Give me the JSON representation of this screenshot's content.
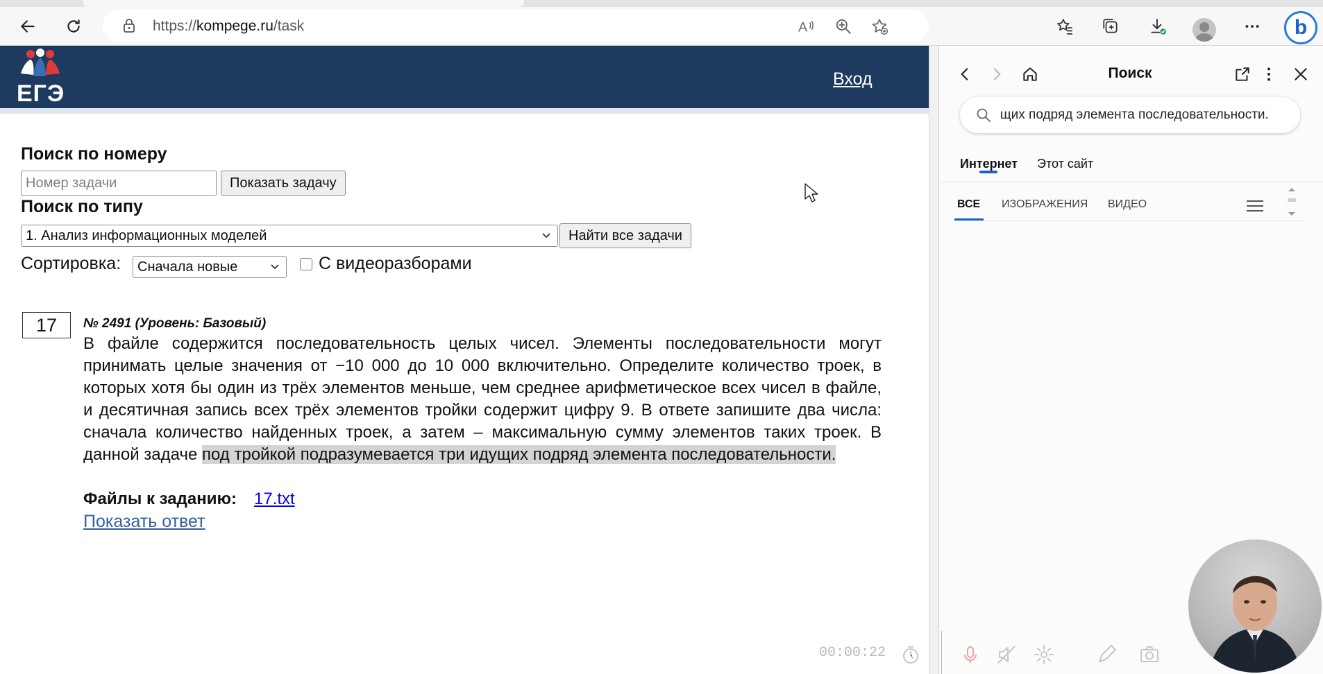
{
  "browser": {
    "url_prefix": "https://",
    "url_domain": "kompege.ru",
    "url_path": "/task"
  },
  "site": {
    "logo_text": "ЕГЭ",
    "login_label": "Вход"
  },
  "search_by_number": {
    "heading": "Поиск по номеру",
    "input_placeholder": "Номер задачи",
    "input_value": "",
    "button_label": "Показать задачу"
  },
  "search_by_type": {
    "heading": "Поиск по типу",
    "selected_type": "1. Анализ информационных моделей",
    "button_label": "Найти все задачи"
  },
  "sorting": {
    "label": "Сортировка:",
    "selected": "Сначала новые",
    "checkbox_label": "С видеоразборами",
    "checkbox_checked": false
  },
  "task": {
    "number": "17",
    "meta": "№ 2491 (Уровень: Базовый)",
    "text_main": "В файле содержится последовательность целых чисел. Элементы последовательности могут принимать целые значения от −10 000 до 10 000 включительно. Определите количество троек, в которых хотя бы один из трёх элементов меньше, чем среднее арифметическое всех чисел в файле, и десятичная запись всех трёх элементов тройки содержит цифру 9. В ответе запишите два числа: сначала количество найденных троек, а затем – максимальную сумму элементов таких троек. В данной задаче ",
    "text_highlighted": "под тройкой подразумевается три идущих подряд элемента последовательности.",
    "files_label": "Файлы к заданию:",
    "file_name": "17.txt",
    "show_answer": "Показать ответ"
  },
  "sidebar": {
    "title": "Поиск",
    "query": "щих подряд элемента последовательности.",
    "scopes": [
      "Интернет",
      "Этот сайт"
    ],
    "active_scope": "Интернет",
    "verticals": [
      "ВСЕ",
      "ИЗОБРАЖЕНИЯ",
      "ВИДЕО"
    ],
    "active_vertical": "ВСЕ"
  },
  "recorder": {
    "timer": "00:00:22"
  },
  "colors": {
    "site_header": "#1e3a5f",
    "highlight": "#d4d4d4",
    "link": "#0000ee",
    "accent": "#1a64c8"
  }
}
